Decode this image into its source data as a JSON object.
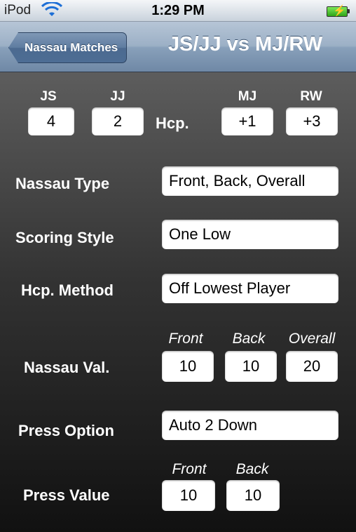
{
  "status_bar": {
    "carrier": "iPod",
    "time": "1:29 PM",
    "wifi_icon": "wifi-icon",
    "battery_icon": "battery-charging-icon"
  },
  "nav": {
    "back_label": "Nassau Matches",
    "title": "JS/JJ vs MJ/RW"
  },
  "players": {
    "team1": [
      {
        "initials": "JS",
        "hcp": "4"
      },
      {
        "initials": "JJ",
        "hcp": "2"
      }
    ],
    "hcp_label": "Hcp.",
    "team2": [
      {
        "initials": "MJ",
        "hcp": "+1"
      },
      {
        "initials": "RW",
        "hcp": "+3"
      }
    ]
  },
  "settings": {
    "nassau_type": {
      "label": "Nassau Type",
      "value": "Front, Back, Overall"
    },
    "scoring_style": {
      "label": "Scoring Style",
      "value": "One Low"
    },
    "hcp_method": {
      "label": "Hcp. Method",
      "value": "Off Lowest Player"
    },
    "nassau_val": {
      "label": "Nassau Val.",
      "columns": [
        "Front",
        "Back",
        "Overall"
      ],
      "values": [
        "10",
        "10",
        "20"
      ]
    },
    "press_option": {
      "label": "Press Option",
      "value": "Auto 2 Down"
    },
    "press_value": {
      "label": "Press Value",
      "columns": [
        "Front",
        "Back"
      ],
      "values": [
        "10",
        "10"
      ]
    }
  },
  "colors": {
    "nav_bar": "#8aa2bc",
    "back_button": "#5a7aa0",
    "content_top": "#5d5d5d",
    "content_bottom": "#111111"
  }
}
